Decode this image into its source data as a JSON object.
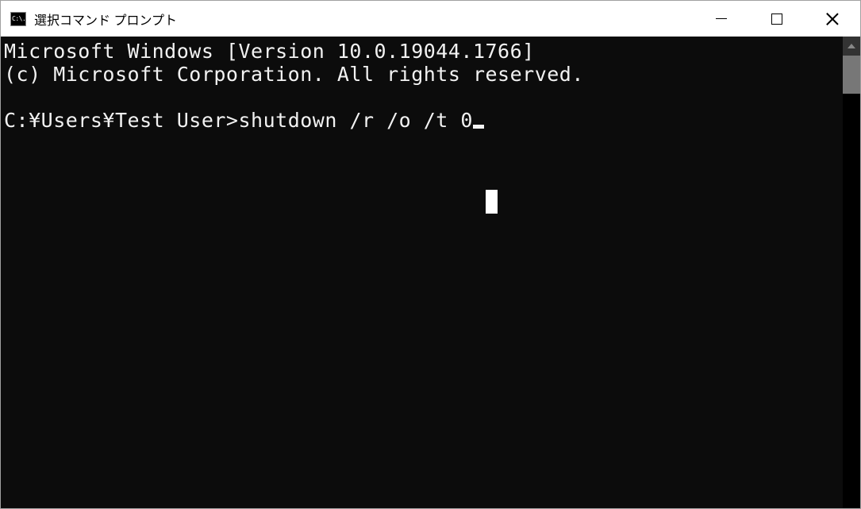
{
  "window": {
    "title": "選択コマンド プロンプト",
    "icon_text": "C:\\."
  },
  "terminal": {
    "line1": "Microsoft Windows [Version 10.0.19044.1766]",
    "line2": "(c) Microsoft Corporation. All rights reserved.",
    "prompt": "C:¥Users¥Test User>",
    "command": "shutdown /r /o /t 0"
  }
}
